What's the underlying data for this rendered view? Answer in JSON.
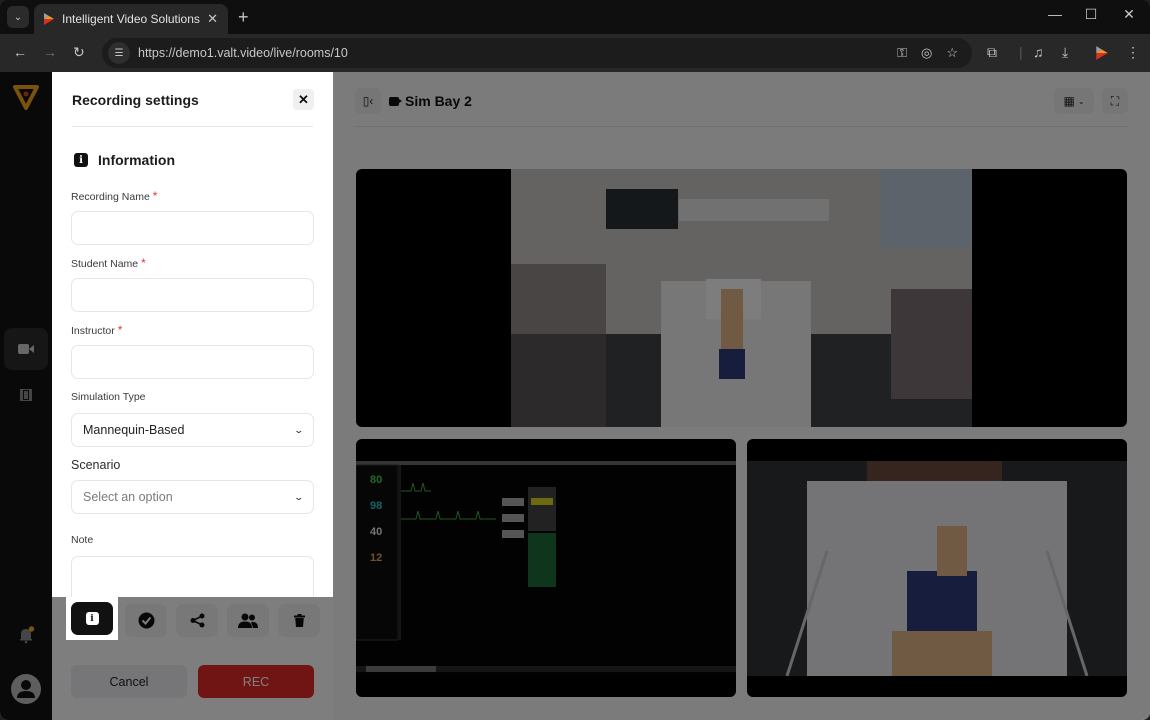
{
  "browser": {
    "tab_title": "Intelligent Video Solutions",
    "url": "https://demo1.valt.video/live/rooms/10",
    "new_tab_glyph": "+",
    "close_glyph": "✕"
  },
  "drawer": {
    "title": "Recording settings",
    "section_title": "Information",
    "fields": {
      "recording_name": {
        "label": "Recording Name",
        "required_mark": "*",
        "value": ""
      },
      "student_name": {
        "label": "Student Name",
        "required_mark": "*",
        "value": ""
      },
      "instructor": {
        "label": "Instructor",
        "required_mark": "*",
        "value": ""
      },
      "simulation_type": {
        "label": "Simulation Type",
        "value": "Mannequin-Based"
      },
      "scenario": {
        "label": "Scenario",
        "placeholder": "Select an option"
      },
      "note": {
        "label": "Note",
        "value": ""
      }
    },
    "action_tabs": [
      {
        "name": "information",
        "icon": "info-icon",
        "active": true
      },
      {
        "name": "status",
        "icon": "check-circle-icon",
        "active": false
      },
      {
        "name": "share",
        "icon": "share-icon",
        "active": false
      },
      {
        "name": "users",
        "icon": "users-icon",
        "active": false
      },
      {
        "name": "delete",
        "icon": "trash-icon",
        "active": false
      }
    ],
    "cancel_label": "Cancel",
    "rec_label": "REC"
  },
  "main": {
    "room_title": "Sim Bay 2",
    "feeds": [
      {
        "name": "room-overview-camera"
      },
      {
        "name": "patient-monitor-feed",
        "vitals": [
          "80",
          "98",
          "40",
          "12"
        ]
      },
      {
        "name": "bed-overhead-camera"
      }
    ]
  },
  "leftnav": {
    "items": [
      {
        "name": "live-rooms",
        "icon": "video-camera-icon",
        "active": true
      },
      {
        "name": "recordings",
        "icon": "film-icon",
        "active": false
      }
    ],
    "notification_dot": true
  },
  "colors": {
    "brand_orange": "#f2a51d",
    "rec_red": "#e32b28",
    "required_red": "#e5343b",
    "notification_dot": "#f5a623"
  }
}
